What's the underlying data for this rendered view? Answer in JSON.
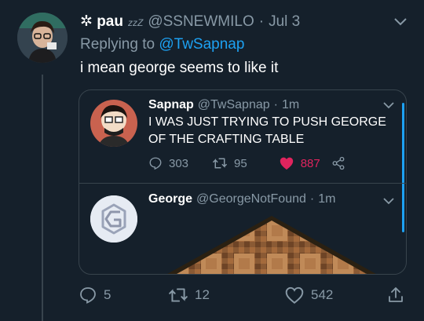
{
  "tweet": {
    "display_name": "✲ pau",
    "name_badge": "zzZ",
    "handle": "@SSNEWMILO",
    "separator": "·",
    "date": "Jul 3",
    "replying_prefix": "Replying to",
    "replying_to": "@TwSapnap",
    "text": "i mean george seems to like it",
    "actions": {
      "replies": "5",
      "retweets": "12",
      "likes": "542"
    }
  },
  "quoted_thread": [
    {
      "name": "Sapnap",
      "handle": "@TwSapnap",
      "separator": "·",
      "time": "1m",
      "text": "I WAS JUST TRYING TO PUSH GEORGE OF THE CRAFTING TABLE",
      "replies": "303",
      "retweets": "95",
      "likes": "887"
    },
    {
      "name": "George",
      "handle": "@GeorgeNotFound",
      "separator": "·",
      "time": "1m"
    }
  ],
  "colors": {
    "background": "#15202b",
    "accent": "#1da1f2",
    "muted": "#8899a6",
    "like": "#e0245e",
    "border": "#38444d"
  },
  "icons": [
    "reply-icon",
    "retweet-icon",
    "like-icon",
    "share-icon",
    "caret-down-icon"
  ]
}
